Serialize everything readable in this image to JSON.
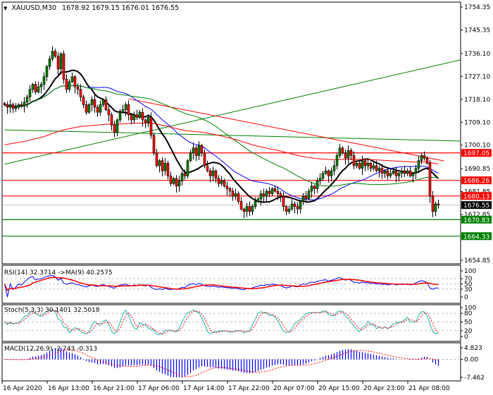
{
  "chart_data": {
    "type": "candlestick",
    "symbol": "XAUUSD",
    "timeframe": "M30",
    "header": {
      "arrow": "▼",
      "title": "XAUUSD,M30",
      "ohlc": "1678.92 1679.15 1676.01 1676.55"
    },
    "ylim": [
      1654.85,
      1754.35
    ],
    "price_ticks": [
      "1754.35",
      "1745.35",
      "1736.10",
      "1727.10",
      "1718.10",
      "1709.10",
      "1700.10",
      "1690.85",
      "1681.85",
      "1672.85",
      "1654.85"
    ],
    "x_tick_labels": [
      "16 Apr 2020",
      "16 Apr 13:00",
      "16 Apr 21:00",
      "17 Apr 06:00",
      "17 Apr 14:00",
      "17 Apr 22:00",
      "20 Apr 07:00",
      "20 Apr 15:00",
      "20 Apr 23:00",
      "21 Apr 08:00"
    ],
    "x_tick_every_bars": 16,
    "closes": [
      1716,
      1715,
      1716,
      1714.5,
      1715,
      1716,
      1715.5,
      1717,
      1719,
      1722,
      1724,
      1721,
      1723,
      1724,
      1727,
      1731,
      1734,
      1737,
      1735,
      1730,
      1736,
      1726,
      1722,
      1725,
      1727,
      1723,
      1722,
      1719,
      1716,
      1713,
      1716,
      1718,
      1715,
      1713,
      1716,
      1718,
      1714,
      1712,
      1708,
      1705,
      1710,
      1713,
      1714,
      1716,
      1712,
      1710,
      1712,
      1711,
      1713,
      1710,
      1709,
      1711,
      1704,
      1697,
      1692,
      1694,
      1690,
      1693,
      1688,
      1685,
      1687,
      1684,
      1686,
      1689,
      1688,
      1694,
      1697,
      1699,
      1696,
      1700,
      1697,
      1692,
      1690,
      1688,
      1690,
      1687,
      1685,
      1686,
      1684,
      1683,
      1682,
      1680,
      1681,
      1678,
      1675,
      1674,
      1676,
      1674,
      1676,
      1678,
      1679,
      1681,
      1680,
      1682,
      1681,
      1683,
      1682,
      1681,
      1680,
      1676,
      1674,
      1675,
      1677,
      1676,
      1675,
      1678,
      1680,
      1679,
      1682,
      1684,
      1683,
      1686,
      1687,
      1689,
      1690,
      1688,
      1690,
      1692,
      1696,
      1699,
      1697,
      1695,
      1698,
      1696,
      1692,
      1693,
      1691,
      1694,
      1692,
      1693,
      1691,
      1692,
      1690,
      1691,
      1689,
      1690,
      1688,
      1689,
      1690,
      1688,
      1689,
      1690,
      1689,
      1690,
      1688,
      1689,
      1691,
      1694,
      1696,
      1695,
      1693,
      1680,
      1674,
      1677,
      1676.55
    ],
    "current_price": {
      "value": 1676.55,
      "label": "1676.55"
    },
    "levels": [
      {
        "value": 1697.05,
        "label": "1697.05",
        "color": "#ff0000"
      },
      {
        "value": 1686.26,
        "label": "1686.26",
        "color": "#ff0000"
      },
      {
        "value": 1680.13,
        "label": "1680.13",
        "color": "#ff0000"
      },
      {
        "value": 1670.83,
        "label": "1670.83",
        "color": "#008000"
      },
      {
        "value": 1664.33,
        "label": "1664.33",
        "color": "#008000"
      }
    ],
    "trendlines": [
      {
        "from": [
          0,
          1692.6
        ],
        "to": [
          172,
          1733.6
        ],
        "color": "#008000"
      },
      {
        "from": [
          0,
          1706.1
        ],
        "to": [
          172,
          1701.7
        ],
        "color": "#008000"
      },
      {
        "from": [
          44,
          1718.3
        ],
        "to": [
          156,
          1693.9
        ],
        "color": "#ff0000"
      }
    ],
    "moving_averages": [
      {
        "period": 12,
        "color": "#000000"
      },
      {
        "period": 30,
        "color": "#0000ff"
      },
      {
        "period": 60,
        "color": "#008000"
      },
      {
        "period": 150,
        "color": "#ff0000",
        "seed": 1700
      }
    ],
    "indicators": {
      "rsi": {
        "label": "RSI(14) 32.3714  ->MA(9) 40.2575",
        "ticks": [
          "100",
          "70",
          "50",
          "30",
          "0"
        ]
      },
      "stoch": {
        "label": "Stoch(5,3,3) 30.1401 32.5018",
        "ticks": [
          "100",
          "80",
          "50",
          "20",
          "0"
        ]
      },
      "macd": {
        "label": "MACD(12,26,9) -2.743 -0.313",
        "ticks": [
          "4.823",
          "0.00",
          "-7.462"
        ],
        "range": [
          -7.462,
          4.823
        ]
      }
    },
    "colors": {
      "bull": "#008000",
      "bear": "#ff0000",
      "current": "#000000",
      "grid": "#c0c0c0"
    }
  }
}
